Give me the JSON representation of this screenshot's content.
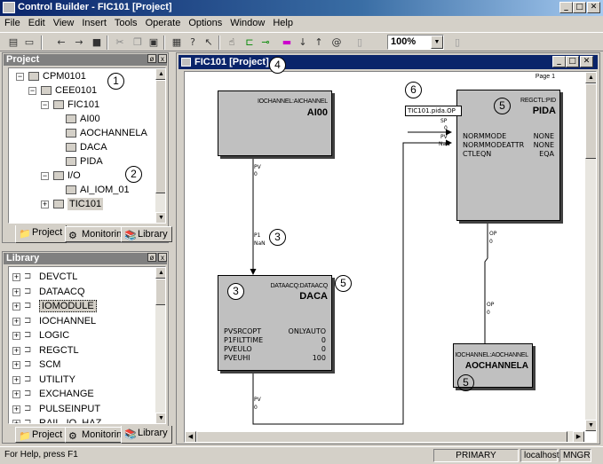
{
  "window": {
    "title": "Control Builder - FIC101 [Project]"
  },
  "menu": [
    "File",
    "Edit",
    "View",
    "Insert",
    "Tools",
    "Operate",
    "Options",
    "Window",
    "Help"
  ],
  "toolbar": {
    "zoom": "100%"
  },
  "project_panel": {
    "title": "Project",
    "tree": [
      {
        "label": "CPM0101",
        "expander": "−",
        "icon": "controller-icon"
      },
      {
        "label": "CEE0101",
        "expander": "−",
        "icon": "folder-icon"
      },
      {
        "label": "FIC101",
        "expander": "−",
        "icon": "control-module-icon"
      },
      {
        "label": "AI00",
        "expander": "",
        "icon": "block-icon"
      },
      {
        "label": "AOCHANNELA",
        "expander": "",
        "icon": "block-icon"
      },
      {
        "label": "DACA",
        "expander": "",
        "icon": "block-icon"
      },
      {
        "label": "PIDA",
        "expander": "",
        "icon": "block-icon"
      },
      {
        "label": "I/O",
        "expander": "−",
        "icon": "io-icon"
      },
      {
        "label": "AI_IOM_01",
        "expander": "",
        "icon": "io-module-icon"
      },
      {
        "label": "TIC101",
        "expander": "+",
        "icon": "control-module-icon"
      }
    ],
    "tabs": [
      "Project",
      "Monitoring",
      "Library"
    ]
  },
  "library_panel": {
    "title": "Library",
    "items": [
      "DEVCTL",
      "DATAACQ",
      "IOMODULE",
      "IOCHANNEL",
      "LOGIC",
      "REGCTL",
      "SCM",
      "UTILITY",
      "EXCHANGE",
      "PULSEINPUT",
      "RAIL_IO_HAZ"
    ],
    "tabs": [
      "Project",
      "Monitoring",
      "Library"
    ]
  },
  "chart_window": {
    "title": "FIC101 [Project]",
    "page_label": "Page 1",
    "blocks": {
      "ai00": {
        "type": "IOCHANNEL:AICHANNEL",
        "name": "AI00",
        "pin_out": "PV"
      },
      "daca": {
        "type": "DATAACQ:DATAACQ",
        "name": "DACA",
        "pin_in": "P1",
        "pin_out": "PV",
        "params": [
          [
            "PVSRCOPT",
            "ONLYAUTO"
          ],
          [
            "P1FILTTIME",
            "0"
          ],
          [
            "PVEULO",
            "0"
          ],
          [
            "PVEUHI",
            "100"
          ]
        ]
      },
      "pida": {
        "type": "REGCTL:PID",
        "name": "PIDA",
        "pin_sp": "SP",
        "pin_pv": "PV",
        "pin_out": "OP",
        "params": [
          [
            "NORMMODE",
            "NONE"
          ],
          [
            "NORMMODEATTR",
            "NONE"
          ],
          [
            "CTLEQN",
            "EQA"
          ]
        ]
      },
      "aochannela": {
        "type": "IOCHANNEL:AOCHANNEL",
        "name": "AOCHANNELA",
        "pin_in": "OP"
      }
    },
    "wire_labels": {
      "ai_pv": "PV",
      "ai_pv_val": "0",
      "daca_p1": "P1",
      "daca_p1_val": "NaN",
      "daca_pv": "PV",
      "daca_pv_val": "0",
      "pida_op": "OP",
      "pida_op_val": "0",
      "ao_op": "OP",
      "ao_op_val": "0",
      "pida_sp_val": "0",
      "pida_pv_val": "NaN"
    },
    "ref_box": "TIC101.pida.OP",
    "callouts": [
      "1",
      "2",
      "3",
      "4",
      "5",
      "6"
    ]
  },
  "status": {
    "help": "For Help, press F1",
    "mode": "PRIMARY",
    "host": "localhost",
    "user": "MNGR"
  }
}
